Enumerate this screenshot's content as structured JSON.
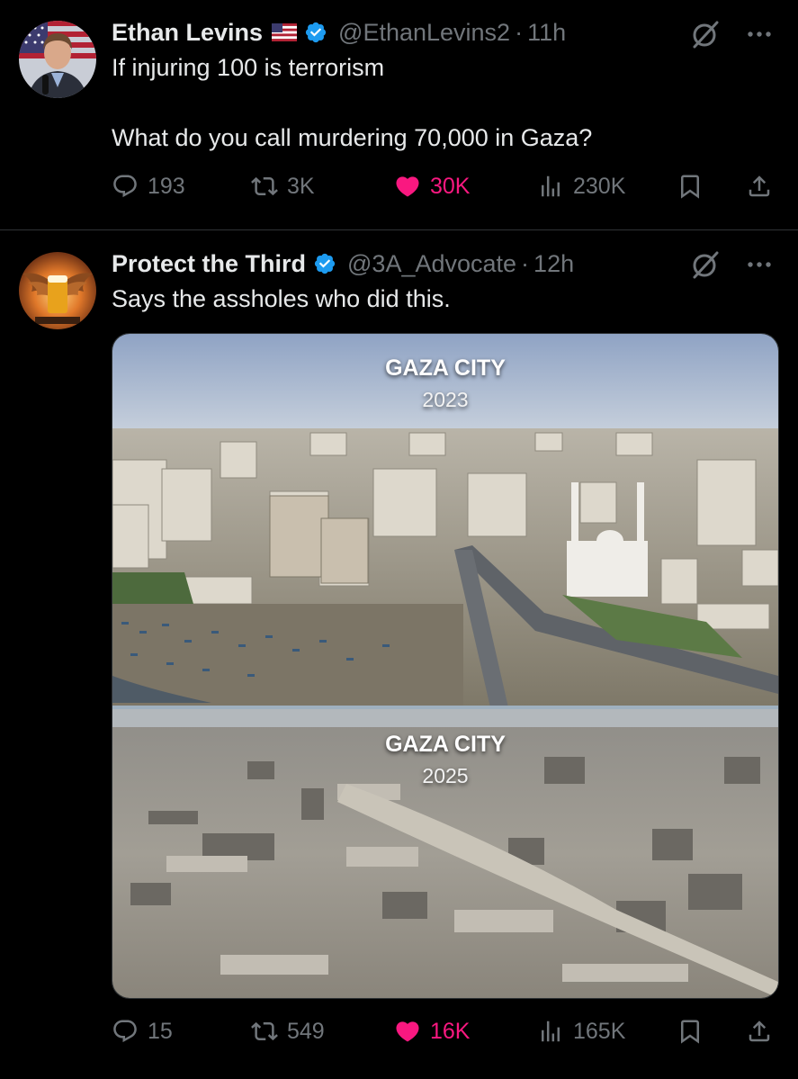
{
  "tweets": [
    {
      "name": "Ethan Levins",
      "handle": "@EthanLevins2",
      "separator": "·",
      "time": "11h",
      "lines": [
        "If injuring 100 is terrorism",
        "What do you call murdering 70,000 in Gaza?"
      ],
      "stats": {
        "replies": "193",
        "reposts": "3K",
        "likes": "30K",
        "views": "230K"
      }
    },
    {
      "name": "Protect the Third",
      "handle": "@3A_Advocate",
      "separator": "·",
      "time": "12h",
      "lines": [
        "Says the assholes who did this."
      ],
      "media": {
        "top": {
          "city": "GAZA CITY",
          "year": "2023"
        },
        "bottom": {
          "city": "GAZA CITY",
          "year": "2025"
        }
      },
      "stats": {
        "replies": "15",
        "reposts": "549",
        "likes": "16K",
        "views": "165K"
      }
    }
  ],
  "icons": [
    "us-flag-icon",
    "verified-icon",
    "grok-icon",
    "more-icon",
    "reply-icon",
    "repost-icon",
    "heart-icon",
    "views-icon",
    "bookmark-icon",
    "share-icon"
  ],
  "colors": {
    "background": "#000000",
    "text": "#e7e9ea",
    "muted": "#71767b",
    "verified": "#1d9bf0",
    "like": "#f91880"
  }
}
